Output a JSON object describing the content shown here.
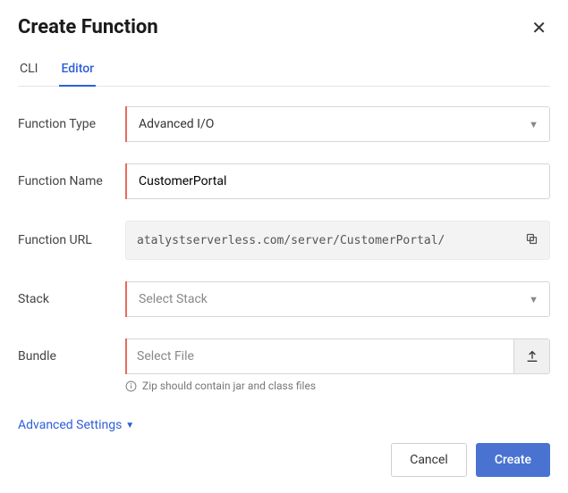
{
  "header": {
    "title": "Create Function"
  },
  "tabs": [
    {
      "label": "CLI",
      "active": false
    },
    {
      "label": "Editor",
      "active": true
    }
  ],
  "fields": {
    "function_type": {
      "label": "Function Type",
      "value": "Advanced I/O"
    },
    "function_name": {
      "label": "Function Name",
      "value": "CustomerPortal"
    },
    "function_url": {
      "label": "Function URL",
      "value": "atalystserverless.com/server/CustomerPortal/"
    },
    "stack": {
      "label": "Stack",
      "placeholder": "Select Stack"
    },
    "bundle": {
      "label": "Bundle",
      "placeholder": "Select File",
      "hint": "Zip should contain jar and class files"
    }
  },
  "advanced_label": "Advanced Settings",
  "buttons": {
    "cancel": "Cancel",
    "create": "Create"
  }
}
